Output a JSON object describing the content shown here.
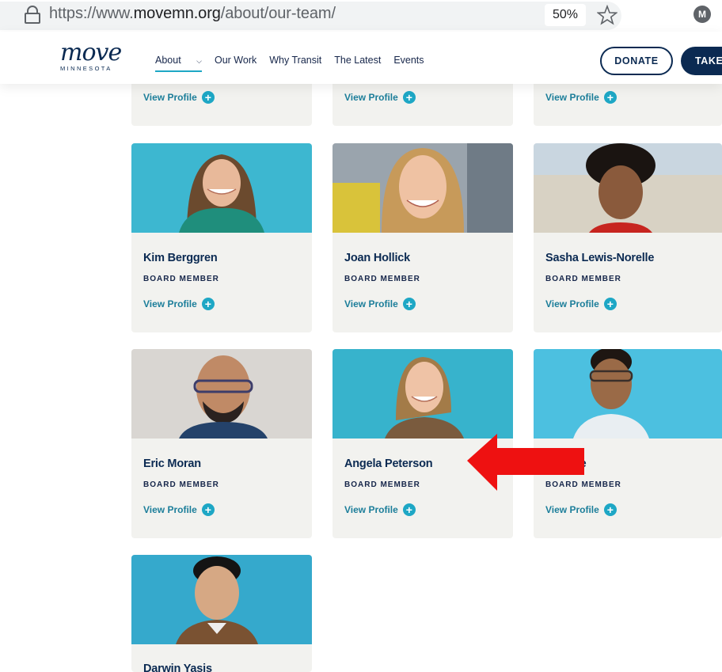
{
  "browser": {
    "url_prefix": "https://www.",
    "url_domain": "movemn.org",
    "url_path": "/about/our-team/",
    "zoom": "50%",
    "profile_initial": "M"
  },
  "nav": {
    "logo_script": "move",
    "logo_sub": "MINNESOTA",
    "items": [
      "About",
      "Our Work",
      "Why Transit",
      "The Latest",
      "Events"
    ],
    "donate": "DONATE",
    "take_action": "TAKE"
  },
  "team": {
    "view_profile": "View Profile",
    "role": "BOARD MEMBER",
    "members": [
      {
        "name": "Kim Berggren",
        "role": "BOARD MEMBER"
      },
      {
        "name": "Joan Hollick",
        "role": "BOARD MEMBER"
      },
      {
        "name": "Sasha Lewis-Norelle",
        "role": "BOARD MEMBER"
      },
      {
        "name": "Eric Moran",
        "role": "BOARD MEMBER"
      },
      {
        "name": "Angela Peterson",
        "role": "BOARD MEMBER"
      },
      {
        "name": "be",
        "role": "BOARD MEMBER"
      },
      {
        "name": "Darwin Yasis",
        "role": ""
      }
    ]
  },
  "colors": {
    "navy": "#0b2a52",
    "accent": "#1ea7c5",
    "card_bg": "#f2f2ef",
    "arrow": "#ee1111"
  }
}
